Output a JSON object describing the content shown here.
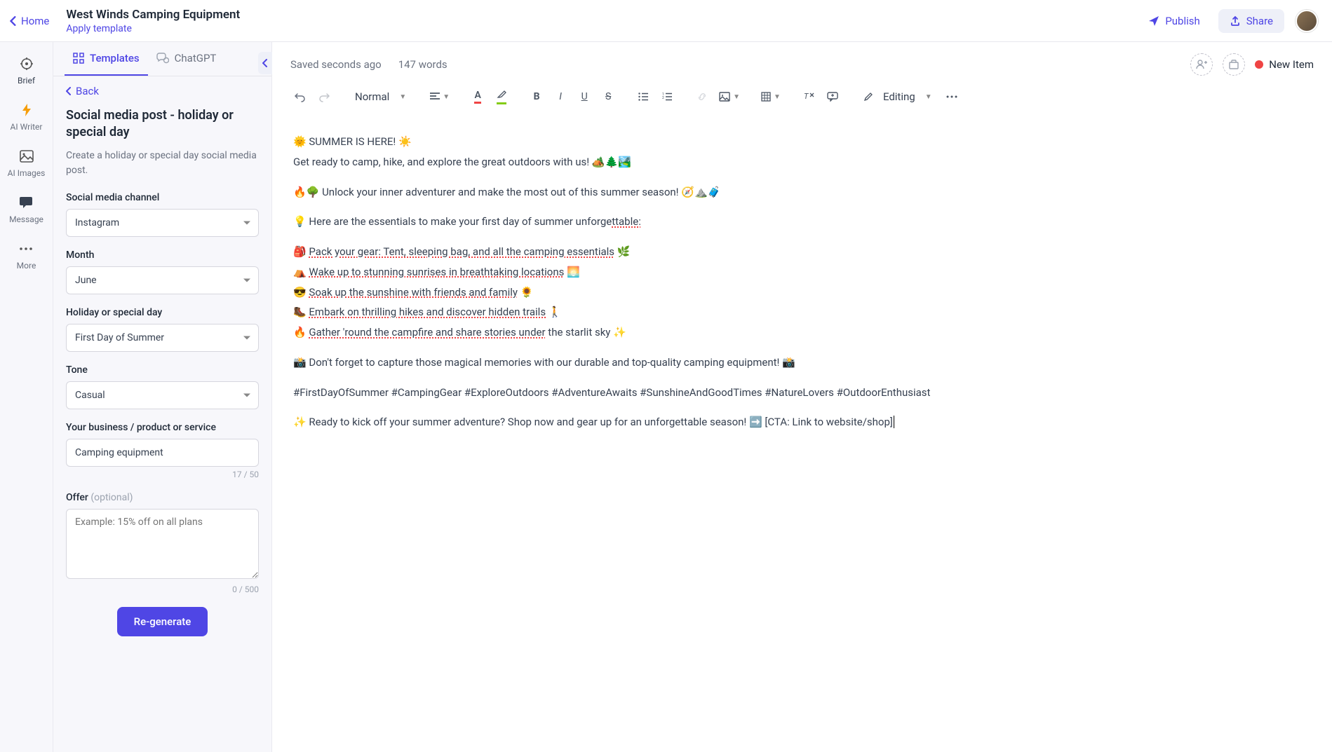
{
  "header": {
    "home_label": "Home",
    "doc_title": "West Winds Camping Equipment",
    "apply_template_label": "Apply template",
    "publish_label": "Publish",
    "share_label": "Share"
  },
  "nav_rail": {
    "brief": "Brief",
    "ai_writer": "AI Writer",
    "ai_images": "AI Images",
    "message": "Message",
    "more": "More"
  },
  "sidebar": {
    "tab_templates": "Templates",
    "tab_chatgpt": "ChatGPT",
    "back_label": "Back",
    "panel_title": "Social media post - holiday or special day",
    "panel_desc": "Create a holiday or special day social media post.",
    "fields": {
      "channel_label": "Social media channel",
      "channel_value": "Instagram",
      "month_label": "Month",
      "month_value": "June",
      "holiday_label": "Holiday or special day",
      "holiday_value": "First Day of Summer",
      "tone_label": "Tone",
      "tone_value": "Casual",
      "business_label": "Your business / product or service",
      "business_value": "Camping equipment",
      "business_count": "17 / 50",
      "offer_label": "Offer",
      "offer_optional": "(optional)",
      "offer_placeholder": "Example: 15% off on all plans",
      "offer_count": "0 / 500"
    },
    "regenerate_label": "Re-generate"
  },
  "editor": {
    "saved_text": "Saved seconds ago",
    "word_count": "147 words",
    "new_item_label": "New Item",
    "style_select": "Normal",
    "editing_label": "Editing",
    "content": {
      "l1": "🌞 SUMMER IS HERE! ☀️",
      "l2": "Get ready to camp, hike, and explore the great outdoors with us! 🏕️🌲🏞️",
      "l3": "🔥🌳 Unlock your inner adventurer and make the most out of this summer season! 🧭⛰️🧳",
      "l4_prefix": "💡 Here are the essentials to make your first day of summer unforge",
      "l4_spell": "ttable:",
      "l5_icon": "🎒 ",
      "l5_spell": "Pack your gear: Tent, sleeping bag, and all the camping essentials",
      "l5_tail": " 🌿",
      "l6_icon": "⛺ ",
      "l6_spell": "Wake up to stunning sunrises in breathtaking locations",
      "l6_tail": " 🌅",
      "l7_icon": "😎 ",
      "l7_spell": "Soak up the sunshine with friends and family",
      "l7_tail": " 🌻",
      "l8_icon": "🥾 ",
      "l8_spell": "Embark on thrilling hikes and discover hidden trails",
      "l8_tail": " 🚶",
      "l9_icon": "🔥 ",
      "l9_spell": "Gather 'round the campfire and share stories under",
      "l9_tail": " the starlit sky ✨",
      "l10": "📸 Don't forget to capture those magical memories with our durable and top-quality camping equipment! 📸",
      "l11": "#FirstDayOfSummer #CampingGear #ExploreOutdoors #AdventureAwaits #SunshineAndGoodTimes #NatureLovers #OutdoorEnthusiast",
      "l12": "✨ Ready to kick off your summer adventure? Shop now and gear up for an unforgettable season! ➡️ [CTA: Link to website/shop]"
    }
  }
}
